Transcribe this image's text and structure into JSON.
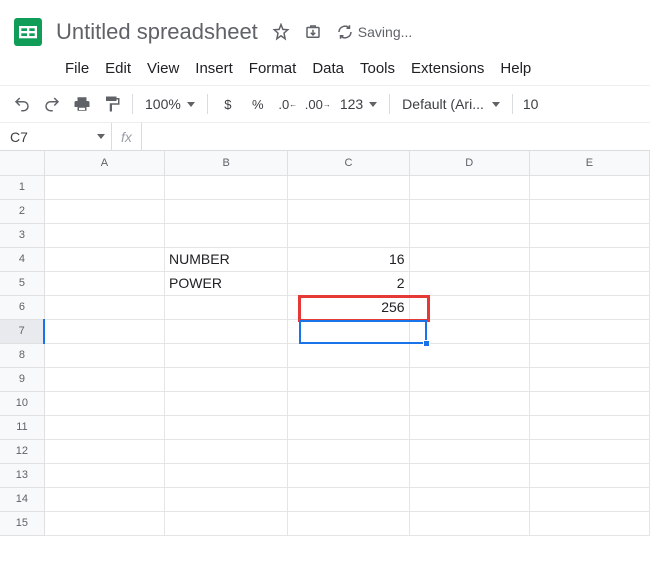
{
  "doc": {
    "title": "Untitled spreadsheet",
    "saving": "Saving..."
  },
  "menu": [
    "File",
    "Edit",
    "View",
    "Insert",
    "Format",
    "Data",
    "Tools",
    "Extensions",
    "Help"
  ],
  "toolbar": {
    "zoom": "100%",
    "currency": "$",
    "percent": "%",
    "dec_dec": ".0",
    "inc_dec": ".00",
    "numfmt": "123",
    "font": "Default (Ari...",
    "font_size": "10"
  },
  "namebox": "C7",
  "fx": "fx",
  "cols": [
    "A",
    "B",
    "C",
    "D",
    "E"
  ],
  "rows": [
    "1",
    "2",
    "3",
    "4",
    "5",
    "6",
    "7",
    "8",
    "9",
    "10",
    "11",
    "12",
    "13",
    "14",
    "15"
  ],
  "cells": {
    "B4": "NUMBER",
    "B5": "POWER",
    "C4": "16",
    "C5": "2",
    "C6": "256"
  },
  "active_row": "7"
}
